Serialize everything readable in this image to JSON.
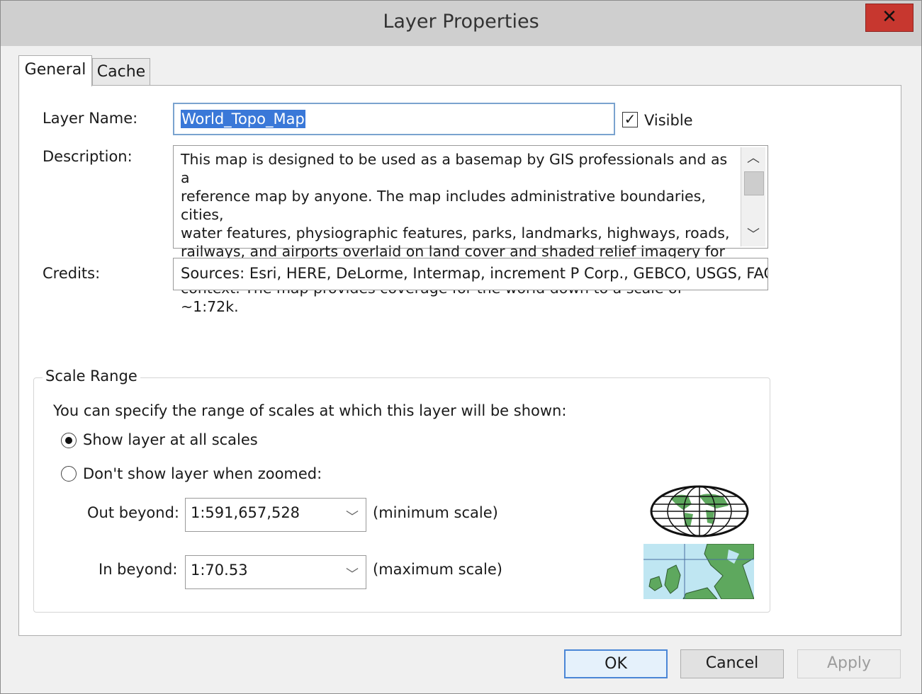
{
  "window": {
    "title": "Layer Properties",
    "close_glyph": "✕"
  },
  "tabs": [
    {
      "label": "General",
      "active": true
    },
    {
      "label": "Cache",
      "active": false
    }
  ],
  "general": {
    "layer_name_label": "Layer Name:",
    "layer_name_value": "World_Topo_Map",
    "visible_label": "Visible",
    "visible_checked": true,
    "description_label": "Description:",
    "description_text": "This map is designed to be used as a basemap by GIS professionals and as a\nreference map by anyone. The map includes administrative boundaries, cities,\nwater features, physiographic features, parks, landmarks, highways, roads,\nrailways, and airports overlaid on land cover and shaded relief imagery for added\ncontext. The map provides coverage for the world down to a scale of ~1:72k.",
    "credits_label": "Credits:",
    "credits_value": "Sources: Esri, HERE, DeLorme, Intermap, increment P Corp., GEBCO, USGS, FAO, NPS"
  },
  "scale_range": {
    "group_title": "Scale Range",
    "intro": "You can specify the range of scales at which this layer will be shown:",
    "option_all": "Show layer at all scales",
    "option_zoomed": "Don't show layer when zoomed:",
    "selected_option": "all",
    "out_beyond_label": "Out beyond:",
    "out_beyond_value": "1:591,657,528",
    "out_beyond_note": "(minimum scale)",
    "in_beyond_label": "In beyond:",
    "in_beyond_value": "1:70.53",
    "in_beyond_note": "(maximum scale)",
    "globe_icon": "world-globe-icon",
    "map_icon": "europe-map-icon"
  },
  "buttons": {
    "ok": "OK",
    "cancel": "Cancel",
    "apply": "Apply"
  },
  "colors": {
    "selection": "#3a78d8",
    "close_button": "#c7372f",
    "land_green": "#5ea85e",
    "water_blue": "#bfe6f2"
  }
}
